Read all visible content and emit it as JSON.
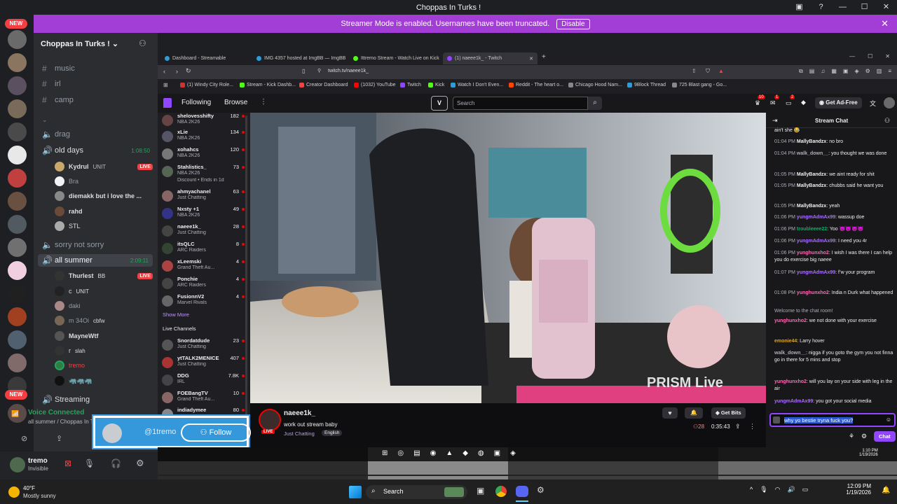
{
  "window": {
    "title": "Choppas In Turks !"
  },
  "banner": {
    "text": "Streamer Mode is enabled. Usernames have been truncated.",
    "button": "Disable"
  },
  "rail": {
    "new_badge": "NEW"
  },
  "server": {
    "name": "Choppas In Turks !",
    "channels": [
      {
        "name": "music"
      },
      {
        "name": "irl"
      },
      {
        "name": "camp"
      }
    ],
    "voice_channels": [
      {
        "name": "drag"
      },
      {
        "name": "old days",
        "timer": "1:08:50"
      },
      {
        "name": "sorry not sorry"
      },
      {
        "name": "all summer",
        "timer": "2:09:11"
      },
      {
        "name": "Streaming"
      }
    ],
    "old_days_users": [
      {
        "name": "Kydrul",
        "tag": "UNIT",
        "live": "LIVE",
        "color": "#c9a86b"
      },
      {
        "name": "Bra",
        "color": "#f2f3f5"
      },
      {
        "name": "diemakk but i love the ...",
        "color": "#888"
      },
      {
        "name": "rahd",
        "color": "#6b4a3a"
      },
      {
        "name": "STL",
        "color": "#aaa"
      }
    ],
    "all_summer_users": [
      {
        "name": "Thurlest",
        "tag": "BB",
        "live": "LIVE",
        "color": "#333"
      },
      {
        "name": "c",
        "tag": "UNIT",
        "color": "#222"
      },
      {
        "name": "daki",
        "color": "#a88"
      },
      {
        "name": "m 34Oi",
        "tag": "cbfw",
        "color": "#765"
      },
      {
        "name": "MayneWtf",
        "color": "#555"
      },
      {
        "name": "r",
        "tag": "slah",
        "color": "#333"
      },
      {
        "name": "tremo",
        "color": "#2d7d46"
      },
      {
        "name": "🦏🦏🦏",
        "color": "#111"
      }
    ]
  },
  "voice": {
    "status": "Voice Connected",
    "location": "all summer / Choppas In T"
  },
  "user": {
    "name": "tremo",
    "status": "Invisible"
  },
  "popup": {
    "handle": "@1tremo",
    "follow": "Follow"
  },
  "browser": {
    "tabs": [
      {
        "label": "Dashboard - Streamable",
        "color": "#2d9cdb"
      },
      {
        "label": "IMG 4357 hosted at ImgBB — ImgBB",
        "color": "#2d9cdb"
      },
      {
        "label": "Ittremo Stream - Watch Live on Kick",
        "color": "#53fc18"
      },
      {
        "label": "(1) naeee1k_ - Twitch",
        "color": "#9146ff"
      }
    ],
    "url": "twitch.tv/naeee1k_",
    "bookmarks": [
      {
        "label": "(1) Windy City Role...",
        "color": "#c33"
      },
      {
        "label": "Stream - Kick Dashb...",
        "color": "#53fc18"
      },
      {
        "label": "Creator Dashboard",
        "color": "#e44"
      },
      {
        "label": "(1032) YouTube",
        "color": "#f00"
      },
      {
        "label": "Twitch",
        "color": "#9146ff"
      },
      {
        "label": "Kick",
        "color": "#53fc18"
      },
      {
        "label": "Watch I Don't Even...",
        "color": "#2d9cdb"
      },
      {
        "label": "Reddit - The heart o...",
        "color": "#ff4500"
      },
      {
        "label": "Chicago Hood Nam...",
        "color": "#888"
      },
      {
        "label": "9Block Thread",
        "color": "#2d9cdb"
      },
      {
        "label": "725 Blast gang - Go...",
        "color": "#888"
      }
    ]
  },
  "twitch": {
    "nav": {
      "following": "Following",
      "browse": "Browse",
      "search_placeholder": "Search",
      "ad_free": "Get Ad-Free",
      "notif1": "10",
      "notif2": "1",
      "notif3": "2"
    },
    "followed": [
      {
        "name": "shelovesshifty",
        "game": "NBA 2K26",
        "viewers": "182",
        "color": "#644"
      },
      {
        "name": "xLie",
        "game": "NBA 2K26",
        "viewers": "134",
        "color": "#556"
      },
      {
        "name": "xohahcs",
        "game": "NBA 2K26",
        "viewers": "120",
        "color": "#777"
      },
      {
        "name": "Stahlistics_",
        "game": "NBA 2K26",
        "viewers": "73",
        "color": "#565",
        "extra": "Discount • Ends in 1d"
      },
      {
        "name": "ahmyachanel",
        "game": "Just Chatting",
        "viewers": "63",
        "color": "#866"
      },
      {
        "name": "Nxsty +1",
        "game": "NBA 2K26",
        "viewers": "49",
        "color": "#338"
      },
      {
        "name": "naeee1k_",
        "game": "Just Chatting",
        "viewers": "28",
        "color": "#444"
      },
      {
        "name": "itsQLC",
        "game": "ARC Raiders",
        "viewers": "8",
        "color": "#343"
      },
      {
        "name": "xLeemski",
        "game": "Grand Theft Au...",
        "viewers": "4",
        "color": "#a44"
      },
      {
        "name": "Ponchie",
        "game": "ARC Raiders",
        "viewers": "4",
        "color": "#444"
      },
      {
        "name": "FusionnV2",
        "game": "Marvel Rivals",
        "viewers": "4",
        "color": "#666"
      }
    ],
    "show_more": "Show More",
    "live_channels_header": "Live Channels",
    "live_channels": [
      {
        "name": "Snordatdude",
        "game": "Just Chatting",
        "viewers": "23",
        "color": "#555"
      },
      {
        "name": "ytTALK2MENICE",
        "game": "Just Chatting",
        "viewers": "407",
        "color": "#a33"
      },
      {
        "name": "DDG",
        "game": "IRL",
        "viewers": "7.8K",
        "color": "#444"
      },
      {
        "name": "FOEBangTV",
        "game": "Grand Theft Au...",
        "viewers": "10",
        "color": "#866"
      },
      {
        "name": "indiadymee",
        "game": "",
        "viewers": "80",
        "color": "#888"
      }
    ],
    "watermark": "PRISM Live",
    "stream": {
      "channel": "naeee1k_",
      "title": "work out stream baby",
      "category": "Just Chatting",
      "tag": "English",
      "live": "LIVE",
      "viewers": "28",
      "uptime": "0:35:43",
      "bits": "Get Bits"
    },
    "chat": {
      "header": "Stream Chat",
      "messages": [
        {
          "time": "",
          "user": "",
          "text": "ain't she 😂",
          "color": "#efeff1"
        },
        {
          "time": "01:04 PM",
          "user": "MallyBandzx",
          "text": ": no bro",
          "color": "#efeff1"
        },
        {
          "time": "01:04 PM",
          "user": "walk_down__",
          "text": ": you thought we was done",
          "color": "#adadb8"
        },
        {
          "time": "01:05 PM",
          "user": "MallyBandzx",
          "text": ": we aint ready for shit",
          "color": "#efeff1"
        },
        {
          "time": "01:05 PM",
          "user": "MallyBandzx",
          "text": ": chubbs said he want you",
          "color": "#efeff1"
        },
        {
          "time": "01:05 PM",
          "user": "MallyBandzx",
          "text": ": yeah",
          "color": "#efeff1"
        },
        {
          "time": "01:06 PM",
          "user": "yungmAdmAx99",
          "text": ": wassup doe",
          "color": "#a970ff"
        },
        {
          "time": "01:06 PM",
          "user": "troubleeee22",
          "text": ": Yoo 😈😈😈😈",
          "color": "#00b36b"
        },
        {
          "time": "01:06 PM",
          "user": "yungmAdmAx99",
          "text": ": I need you 4r",
          "color": "#a970ff"
        },
        {
          "time": "01:06 PM",
          "user": "yunghunxho2",
          "text": ": I wish I was there I can help you do exercise big naeee",
          "color": "#ff69b4"
        },
        {
          "time": "01:07 PM",
          "user": "yungmAdmAx99",
          "text": ": f’w your program",
          "color": "#a970ff"
        },
        {
          "time": "01:08 PM",
          "user": "yunghunxho2",
          "text": ": India n Durk what happened",
          "color": "#ff69b4"
        },
        {
          "time": "",
          "user": "",
          "text": "Welcome to the chat room!",
          "color": "#adadb8"
        },
        {
          "time": "",
          "user": "yunghunxho2",
          "text": ": we not done with your exercise",
          "color": "#ff69b4"
        },
        {
          "time": "",
          "user": "emonie44",
          "text": ": Larry hover",
          "color": "#daa520"
        },
        {
          "time": "",
          "user": "walk_down__",
          "text": ": nigga if you goto the gym you not finna go in there for 5 mins and stop",
          "color": "#adadb8"
        },
        {
          "time": "",
          "user": "yunghunxho2",
          "text": ": will you lay on your side with leg in the air",
          "color": "#ff69b4"
        },
        {
          "time": "",
          "user": "yungmAdmAx99",
          "text": ": you got your social media",
          "color": "#a970ff"
        }
      ],
      "input": "why yo bestie tryna fuck you?",
      "send": "Chat"
    }
  },
  "strip": {
    "time": "1:10 PM",
    "date": "1/19/2026"
  },
  "taskbar": {
    "weather_temp": "40°F",
    "weather_desc": "Mostly sunny",
    "search": "Search",
    "time": "12:09 PM",
    "date": "1/19/2026"
  }
}
